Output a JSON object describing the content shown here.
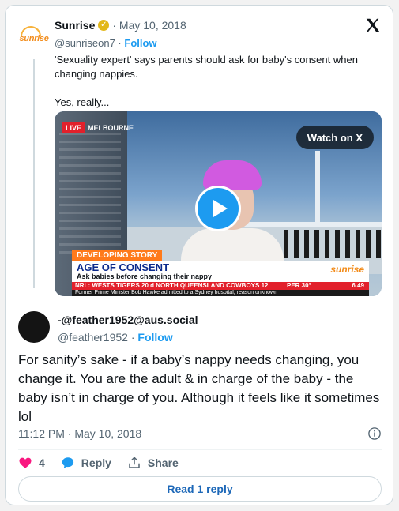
{
  "parent": {
    "logo_text": "sunrise",
    "name": "Sunrise",
    "date": "May 10, 2018",
    "handle": "@sunriseon7",
    "follow": "Follow",
    "text_line1": "'Sexuality expert' says parents should ask for baby's consent when changing nappies.",
    "text_line2": "Yes, really...",
    "verified_color": "#e2b719"
  },
  "video": {
    "live": "LIVE",
    "location": "MELBOURNE",
    "watch_label": "Watch on X",
    "developing": "DEVELOPING STORY",
    "headline": "AGE OF CONSENT",
    "subheadline": "Ask babies before changing their nappy",
    "logo": "sunrise",
    "ticker_nrl": "NRL: WESTS TIGERS 20 d NORTH QUEENSLAND COWBOYS 12",
    "ticker_weather": "PER 30°",
    "ticker_time": "6.49",
    "news_line": "Former Prime Minister Bob Hawke admitted to a Sydney hospital, reason unknown"
  },
  "reply": {
    "name": "-@feather1952@aus.social",
    "handle": "@feather1952",
    "follow": "Follow",
    "text": "For sanity’s sake - if a baby’s nappy needs changing, you change it. You are the adult & in charge of the baby - the baby isn’t in charge of you. Although it feels like it sometimes lol",
    "timestamp": "11:12 PM · May 10, 2018",
    "likes": "4",
    "reply_label": "Reply",
    "share_label": "Share",
    "read_replies": "Read 1 reply"
  },
  "colors": {
    "accent": "#1d9bf0",
    "like": "#f91880",
    "live": "#e2202b"
  }
}
